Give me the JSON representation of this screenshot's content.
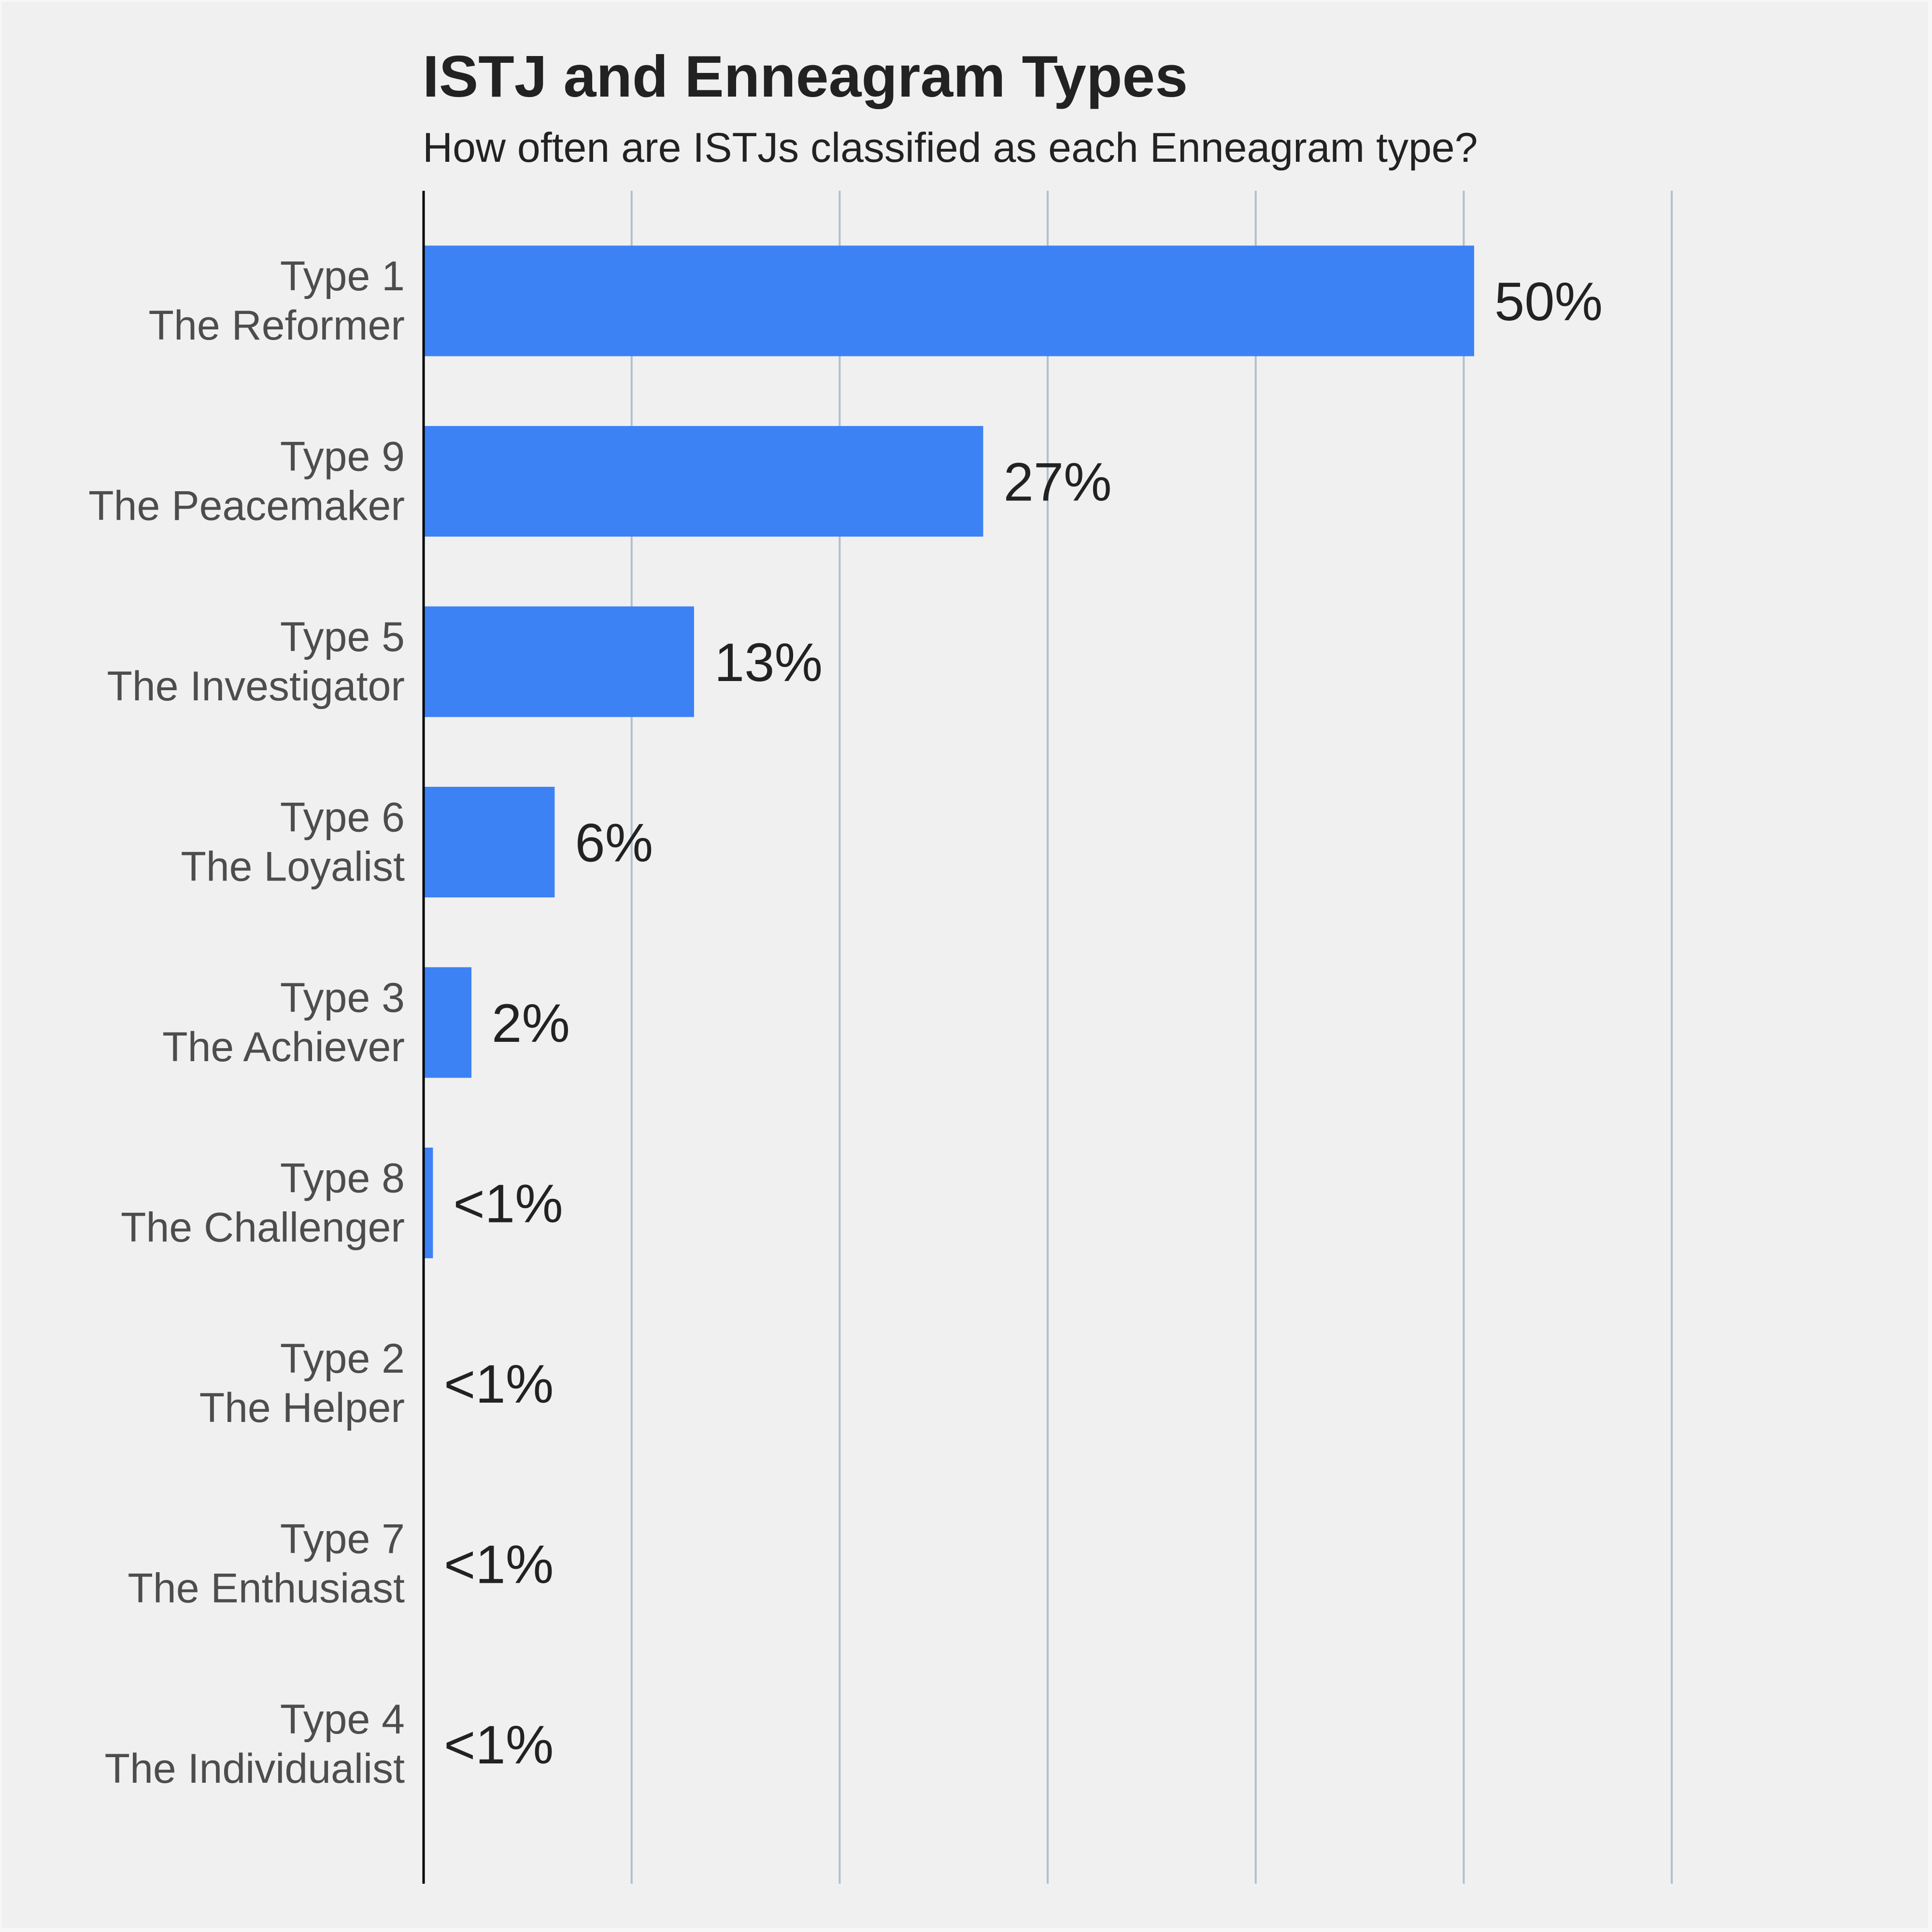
{
  "chart_data": {
    "type": "bar",
    "orientation": "horizontal",
    "title": "ISTJ and Enneagram Types",
    "subtitle": "How often are ISTJs classified as each Enneagram type?",
    "xlabel": "",
    "ylabel": "",
    "categories": [
      {
        "line1": "Type 1",
        "line2": "The Reformer"
      },
      {
        "line1": "Type 9",
        "line2": "The Peacemaker"
      },
      {
        "line1": "Type 5",
        "line2": "The Investigator"
      },
      {
        "line1": "Type 6",
        "line2": "The Loyalist"
      },
      {
        "line1": "Type 3",
        "line2": "The Achiever"
      },
      {
        "line1": "Type 8",
        "line2": "The Challenger"
      },
      {
        "line1": "Type 2",
        "line2": "The Helper"
      },
      {
        "line1": "Type 7",
        "line2": "The Enthusiast"
      },
      {
        "line1": "Type 4",
        "line2": "The Individualist"
      }
    ],
    "values": [
      50.5,
      26.9,
      13.0,
      6.3,
      2.3,
      0.45,
      0.0,
      0.0,
      0.0
    ],
    "value_labels": [
      "50%",
      "27%",
      "13%",
      "6%",
      "2%",
      "<1%",
      "<1%",
      "<1%",
      "<1%"
    ],
    "xlim": [
      0,
      70
    ],
    "gridlines_x": [
      10,
      20,
      30,
      40,
      50,
      60
    ],
    "grid": true,
    "x_tick_labels_shown": false,
    "legend": "none",
    "colors": {
      "bar": "#3d82f5",
      "gridline": "#b0bfcc",
      "axis": "#000000",
      "background": "#f0f0f0"
    }
  }
}
